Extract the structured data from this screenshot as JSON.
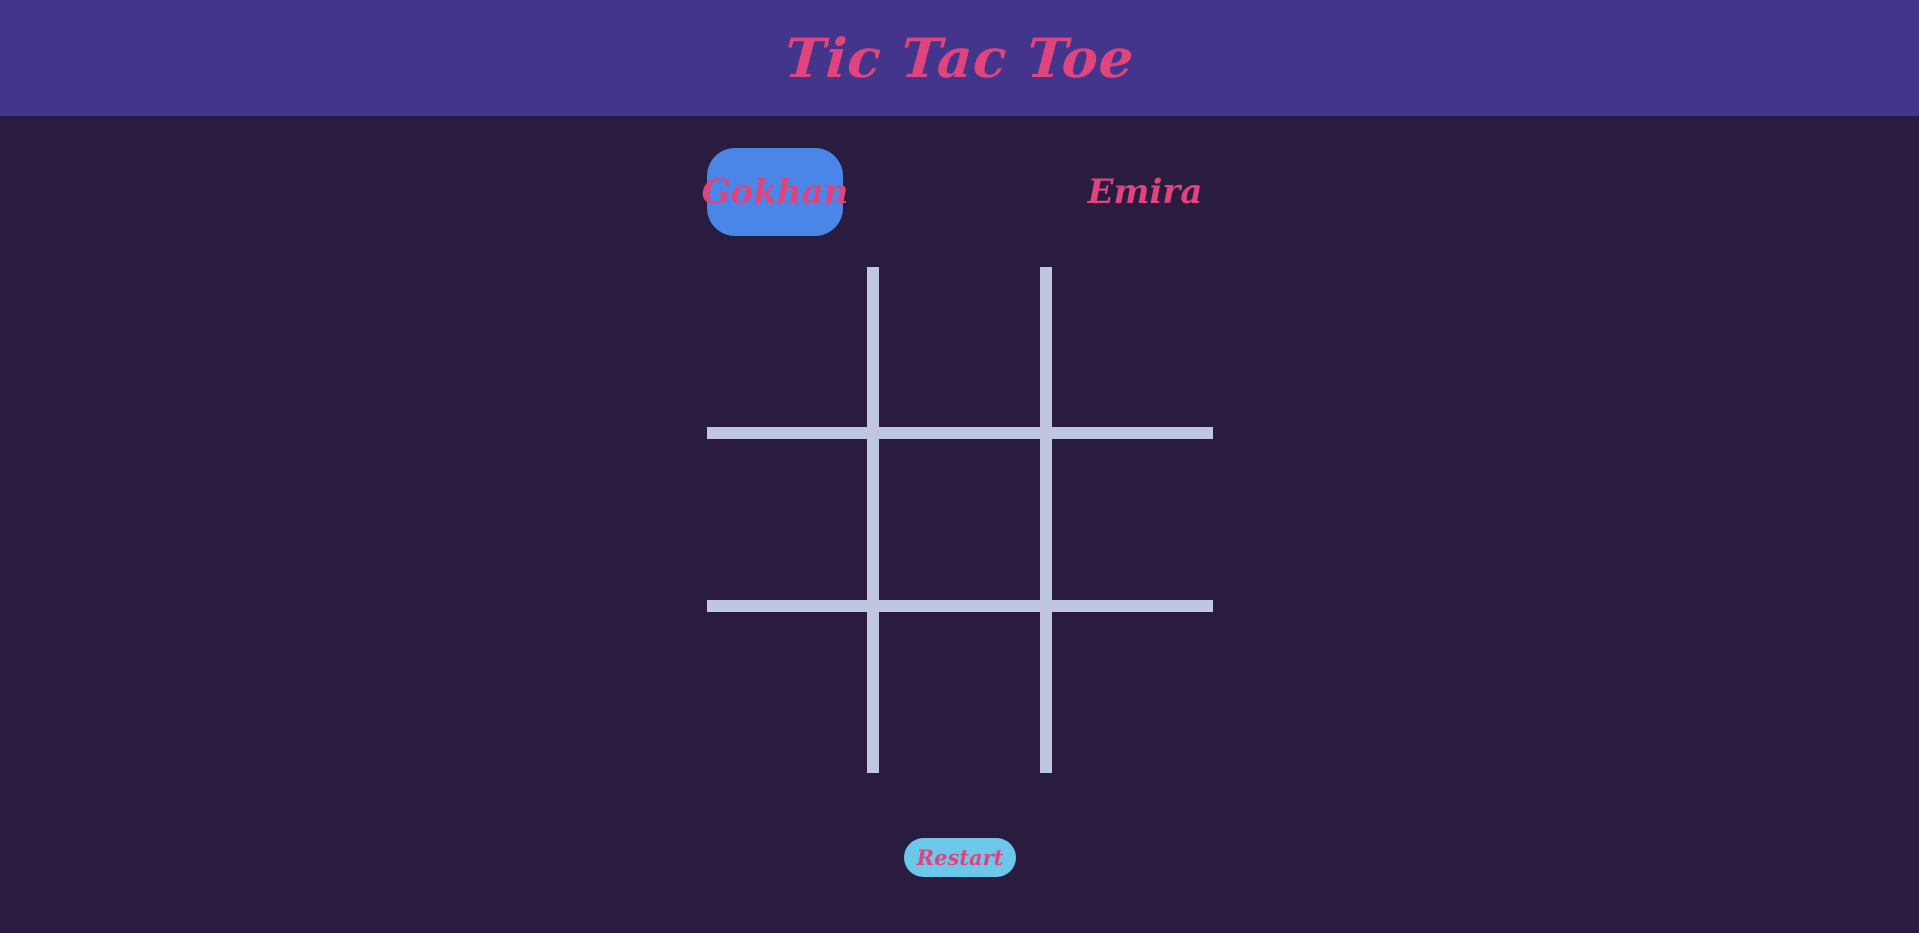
{
  "header": {
    "title": "Tic Tac Toe"
  },
  "players": [
    {
      "name": "Gokhan",
      "active": true
    },
    {
      "name": "Emira",
      "active": false
    }
  ],
  "board": {
    "cells": [
      "",
      "",
      "",
      "",
      "",
      "",
      "",
      "",
      ""
    ]
  },
  "controls": {
    "restart_label": "Restart"
  },
  "colors": {
    "header_bg": "#44358c",
    "page_bg": "#2a1c3e",
    "accent_text": "#e0447d",
    "active_player_bg": "#4a86e8",
    "grid_line": "#c0c5e0",
    "restart_bg": "#6cc8ea"
  }
}
